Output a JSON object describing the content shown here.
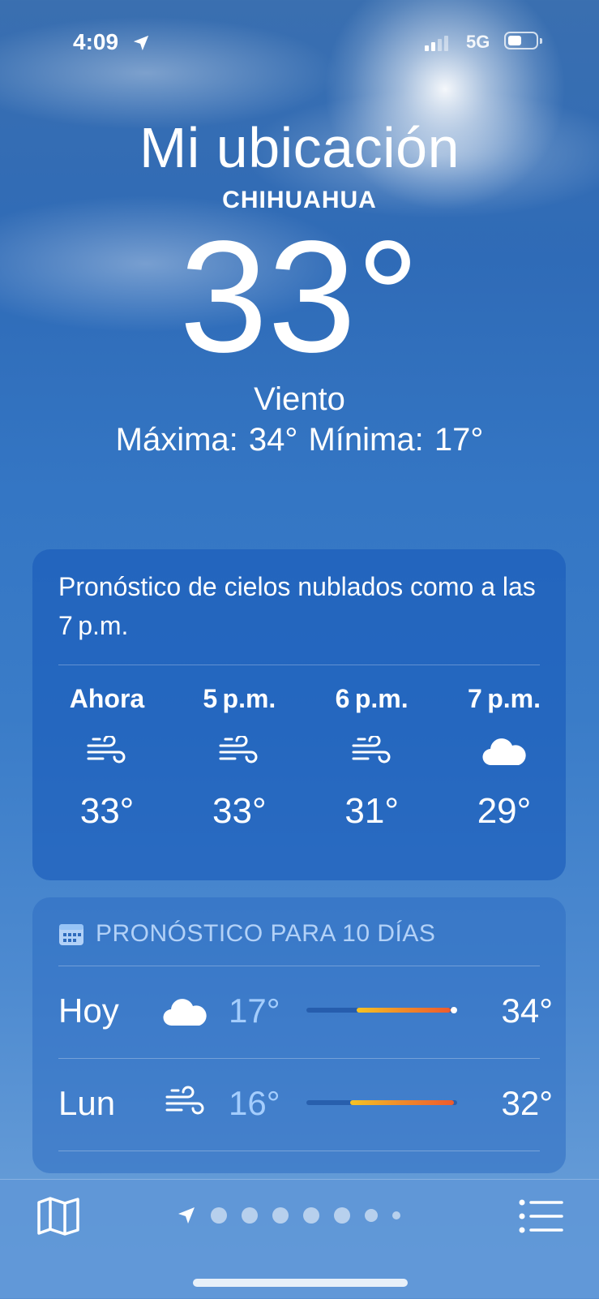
{
  "status_bar": {
    "time": "4:09",
    "network": "5G",
    "location_icon": "location-arrow-icon",
    "signal_icon": "cellular-signal-icon",
    "battery_icon": "battery-icon"
  },
  "header": {
    "location_title": "Mi ubicación",
    "city": "CHIHUAHUA",
    "temperature": "33°",
    "condition": "Viento",
    "high_low": "Máxima: 34°  Mínima: 17°"
  },
  "hourly": {
    "summary": "Pronóstico de cielos nublados como a las 7 p.m.",
    "items": [
      {
        "label": "Ahora",
        "icon": "wind-icon",
        "temp": "33°"
      },
      {
        "label": "5 p.m.",
        "icon": "wind-icon",
        "temp": "33°"
      },
      {
        "label": "6 p.m.",
        "icon": "wind-icon",
        "temp": "31°"
      },
      {
        "label": "7 p.m.",
        "icon": "cloud-icon",
        "temp": "29°"
      }
    ]
  },
  "daily": {
    "title": "PRONÓSTICO PARA 10 DÍAS",
    "title_icon": "calendar-icon",
    "rows": [
      {
        "day": "Hoy",
        "icon": "cloud-icon",
        "low": "17°",
        "high": "34°"
      },
      {
        "day": "Lun",
        "icon": "wind-icon",
        "low": "16°",
        "high": "32°"
      }
    ]
  },
  "bottom_bar": {
    "map_icon": "map-icon",
    "list_icon": "list-icon",
    "pages": 7
  },
  "colors": {
    "accent_bar_start": "#f6c323",
    "accent_bar_end": "#ee5b2d"
  }
}
